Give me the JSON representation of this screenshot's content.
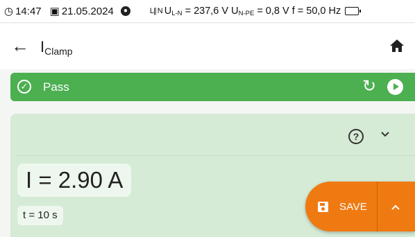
{
  "status": {
    "time": "14:47",
    "date": "21.05.2024",
    "phase_glyph": "L|| N",
    "u_ln_label": "U",
    "u_ln_sub": "L-N",
    "u_ln_value": "= 237,6 V",
    "u_npe_label": "U",
    "u_npe_sub": "N-PE",
    "u_npe_value": "= 0,8 V",
    "freq": "f = 50,0 Hz"
  },
  "appbar": {
    "title_main": "I",
    "title_sub": "Clamp"
  },
  "pass": {
    "label": "Pass"
  },
  "card": {
    "result": "I = 2.90 A",
    "time": "t = 10 s"
  },
  "save": {
    "label": "SAVE"
  },
  "colors": {
    "pass_green": "#4caf50",
    "card_bg": "#d5ebd6",
    "save_orange": "#f07a12"
  }
}
